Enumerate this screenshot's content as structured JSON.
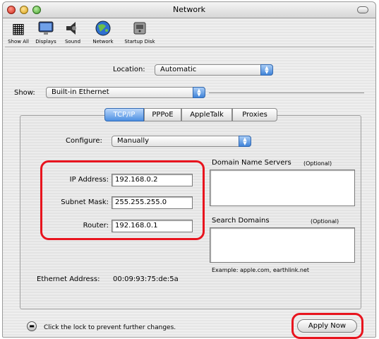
{
  "window": {
    "title": "Network"
  },
  "toolbar": [
    {
      "label": "Show All",
      "icon": "grid-icon"
    },
    {
      "label": "Displays",
      "icon": "display-icon"
    },
    {
      "label": "Sound",
      "icon": "speaker-icon"
    },
    {
      "label": "Network",
      "icon": "globe-icon"
    },
    {
      "label": "Startup Disk",
      "icon": "disk-icon"
    }
  ],
  "location": {
    "label": "Location:",
    "value": "Automatic"
  },
  "show": {
    "label": "Show:",
    "value": "Built-in Ethernet"
  },
  "tabs": [
    {
      "label": "TCP/IP",
      "active": true
    },
    {
      "label": "PPPoE",
      "active": false
    },
    {
      "label": "AppleTalk",
      "active": false
    },
    {
      "label": "Proxies",
      "active": false
    }
  ],
  "configure": {
    "label": "Configure:",
    "value": "Manually"
  },
  "ip": {
    "label": "IP Address:",
    "value": "192.168.0.2"
  },
  "subnet": {
    "label": "Subnet Mask:",
    "value": "255.255.255.0"
  },
  "router": {
    "label": "Router:",
    "value": "192.168.0.1"
  },
  "dns": {
    "label": "Domain Name Servers",
    "optional": "(Optional)"
  },
  "search": {
    "label": "Search Domains",
    "optional": "(Optional)"
  },
  "example": "Example: apple.com, earthlink.net",
  "ethernet": {
    "label": "Ethernet Address:",
    "value": "00:09:93:75:de:5a"
  },
  "footer": {
    "lock_text": "Click the lock to prevent further changes.",
    "apply_label": "Apply Now"
  },
  "colors": {
    "highlight": "#e8141e",
    "accent": "#4c8fe2"
  }
}
